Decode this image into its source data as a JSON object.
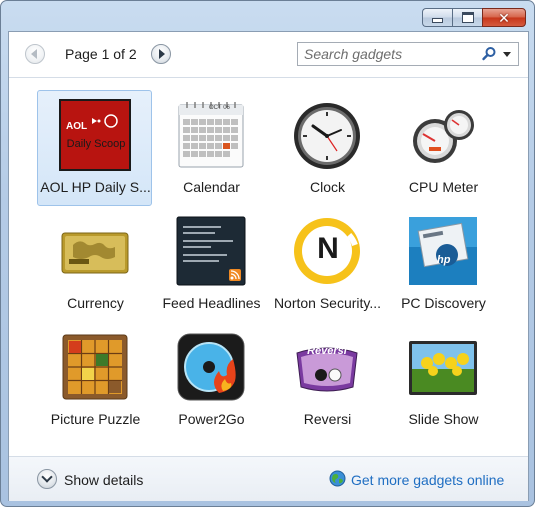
{
  "window": {
    "controls": {
      "minimize": "minimize",
      "maximize": "maximize",
      "close": "✕"
    }
  },
  "pager": {
    "label": "Page 1 of 2"
  },
  "search": {
    "placeholder": "Search gadgets"
  },
  "gadgets": [
    {
      "label": "AOL HP Daily S...",
      "icon": "aol-hp-daily-scoop-icon",
      "selected": true,
      "logo_text": "AOL",
      "tile_text": "Daily Scoop"
    },
    {
      "label": "Calendar",
      "icon": "calendar-icon",
      "month": "OCT 06"
    },
    {
      "label": "Clock",
      "icon": "clock-icon"
    },
    {
      "label": "CPU Meter",
      "icon": "cpu-meter-icon"
    },
    {
      "label": "Currency",
      "icon": "currency-icon"
    },
    {
      "label": "Feed Headlines",
      "icon": "feed-headlines-icon"
    },
    {
      "label": "Norton Security...",
      "icon": "norton-security-icon",
      "logo_letter": "N"
    },
    {
      "label": "PC Discovery",
      "icon": "pc-discovery-icon",
      "logo_text": "hp"
    },
    {
      "label": "Picture Puzzle",
      "icon": "picture-puzzle-icon"
    },
    {
      "label": "Power2Go",
      "icon": "power2go-icon"
    },
    {
      "label": "Reversi",
      "icon": "reversi-icon",
      "logo_text": "Reversi"
    },
    {
      "label": "Slide Show",
      "icon": "slide-show-icon"
    }
  ],
  "footer": {
    "details_label": "Show details",
    "more_link": "Get more gadgets online"
  },
  "colors": {
    "selection_border": "#9ec3ea",
    "selection_fill": "#d4e6f8",
    "link": "#1f6ec2",
    "close_button": "#c7361a"
  }
}
